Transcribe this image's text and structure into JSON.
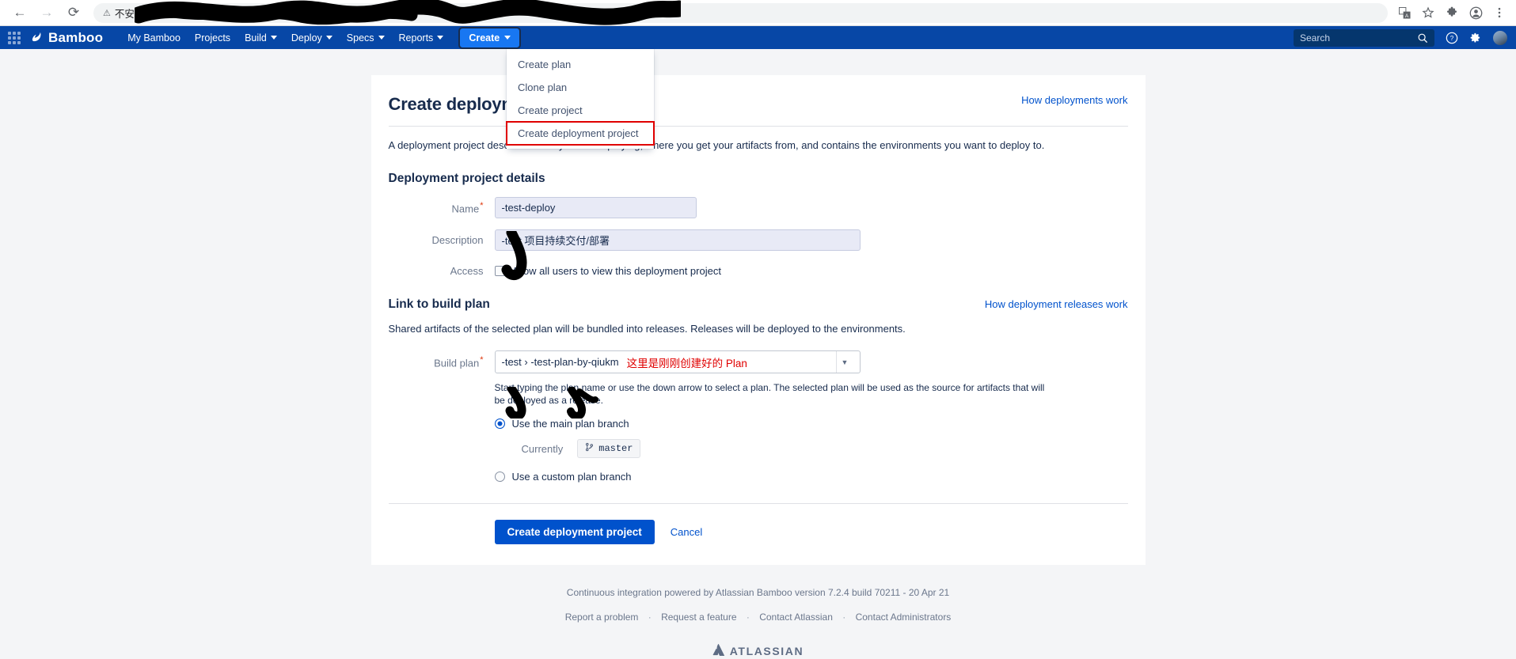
{
  "browser": {
    "back_icon": "back-arrow-icon",
    "forward_icon": "forward-arrow-icon",
    "reload_icon": "reload-icon",
    "security_label": "不安全",
    "security_icon": "warning-triangle-icon",
    "url_text": "",
    "toolbar_icons": [
      "translate-icon",
      "bookmark-star-icon",
      "extensions-puzzle-icon",
      "profile-avatar-icon",
      "browser-menu-icon"
    ]
  },
  "topnav": {
    "app_switcher_icon": "app-switcher-grid-icon",
    "brand": "Bamboo",
    "brand_icon": "bamboo-logo-icon",
    "items": [
      {
        "label": "My Bamboo",
        "caret": false
      },
      {
        "label": "Projects",
        "caret": false
      },
      {
        "label": "Build",
        "caret": true
      },
      {
        "label": "Deploy",
        "caret": true
      },
      {
        "label": "Specs",
        "caret": true
      },
      {
        "label": "Reports",
        "caret": true
      }
    ],
    "create_label": "Create",
    "search_placeholder": "Search",
    "search_icon": "search-icon",
    "help_icon": "help-question-icon",
    "settings_icon": "gear-icon",
    "avatar_icon": "user-avatar"
  },
  "create_menu": {
    "items": [
      {
        "label": "Create plan",
        "highlighted": false
      },
      {
        "label": "Clone plan",
        "highlighted": false
      },
      {
        "label": "Create project",
        "highlighted": false
      },
      {
        "label": "Create deployment project",
        "highlighted": true
      }
    ],
    "highlight_color": "#e00000"
  },
  "main": {
    "title": "Create deployment project",
    "how_deployments_link": "How deployments work",
    "intro": "A deployment project describes what you are deploying, where you get your artifacts from, and contains the environments you want to deploy to.",
    "details_section": "Deployment project details",
    "fields": {
      "name_label": "Name",
      "name_value": "-test-deploy",
      "description_label": "Description",
      "description_value": "-test 项目持续交付/部署",
      "access_label": "Access",
      "access_checkbox_label": "Allow all users to view this deployment project",
      "access_checked": false
    },
    "link_section": "Link to build plan",
    "how_releases_link": "How deployment releases work",
    "link_desc": "Shared artifacts of the selected plan will be bundled into releases. Releases will be deployed to the environments.",
    "build_plan_label": "Build plan",
    "build_plan_value": "-test › -test-plan-by-qiukm",
    "build_plan_annotation": "这里是刚刚创建好的 Plan",
    "build_plan_caret_icon": "chevron-down-icon",
    "plan_help": "Start typing the plan name or use the down arrow to select a plan. The selected plan will be used as the source for artifacts that will be deployed as a release.",
    "radio_main": "Use the main plan branch",
    "radio_main_selected": true,
    "currently_label": "Currently",
    "branch_name": "master",
    "branch_icon": "git-branch-icon",
    "radio_custom": "Use a custom plan branch",
    "radio_custom_selected": false,
    "submit_label": "Create deployment project",
    "cancel_label": "Cancel"
  },
  "footer": {
    "version_line": "Continuous integration powered by Atlassian Bamboo version 7.2.4 build 70211 - 20 Apr 21",
    "links": [
      "Report a problem",
      "Request a feature",
      "Contact Atlassian",
      "Contact Administrators"
    ],
    "separator": "·",
    "atlassian_label": "ATLASSIAN",
    "atlassian_icon": "atlassian-logo-icon"
  }
}
